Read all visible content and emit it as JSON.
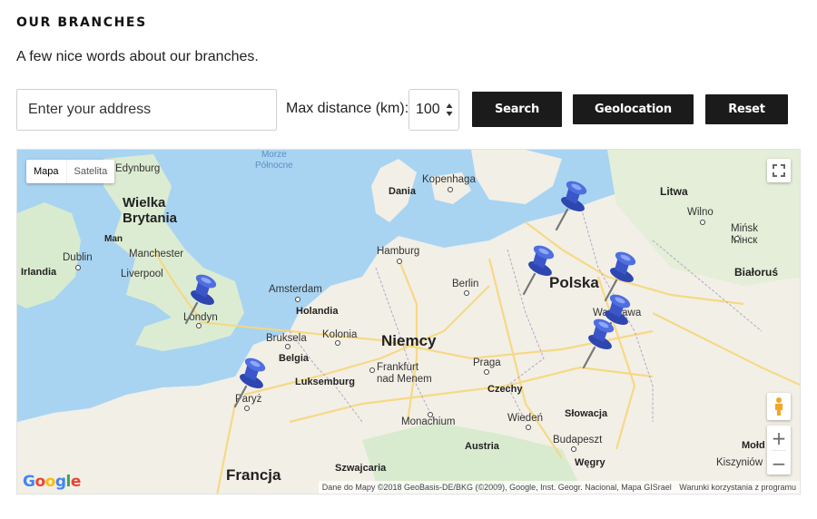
{
  "header": {
    "title": "OUR BRANCHES",
    "subtitle": "A few nice words about our branches."
  },
  "search": {
    "address_placeholder": "Enter your address",
    "max_distance_label": "Max distance (km):",
    "max_distance_value": "100",
    "search_label": "Search",
    "geolocation_label": "Geolocation",
    "reset_label": "Reset"
  },
  "map": {
    "type_control": {
      "map_label": "Mapa",
      "satellite_label": "Satelita",
      "active": "Mapa"
    },
    "labels": {
      "sea_north": "Morze\nPółnocne",
      "edinburgh": "Edynburg",
      "great_britain": "Wielka\nBrytania",
      "isle_of_man": "Man",
      "manchester": "Manchester",
      "dublin": "Dublin",
      "ireland": "Irlandia",
      "liverpool": "Liverpool",
      "london": "Londyn",
      "amsterdam": "Amsterdam",
      "netherlands": "Holandia",
      "brussels": "Bruksela",
      "belgium": "Belgia",
      "cologne": "Kolonia",
      "luxembourg": "Luksemburg",
      "paris": "Paryż",
      "france": "Francja",
      "strasbourg": "Szwajcaria",
      "hamburg": "Hamburg",
      "denmark": "Dania",
      "copenhagen": "Kopenhaga",
      "germany": "Niemcy",
      "berlin": "Berlin",
      "frankfurt": "Frankfurt\nnad Menem",
      "prague": "Praga",
      "czechia": "Czechy",
      "munich": "Monachium",
      "vienna": "Wiedeń",
      "austria": "Austria",
      "slovakia": "Słowacja",
      "budapest": "Budapeszt",
      "hungary": "Węgry",
      "poland": "Polska",
      "warsaw": "Warszawa",
      "lithuania": "Litwa",
      "vilnius": "Wilno",
      "minsk": "Mińsk\nМінск",
      "belarus": "Białoruś",
      "moldova": "Mołd",
      "kishinev": "Kiszyniów"
    },
    "pin_count": 7,
    "google_logo": "Google",
    "attribution": "Dane do Mapy ©2018 GeoBasis-DE/BKG (©2009), Google, Inst. Geogr. Nacional, Mapa GISrael",
    "terms": "Warunki korzystania z programu",
    "colors": {
      "water": "#a8d4f2",
      "land": "#f2efe6",
      "land_green": "#d8ebcf",
      "road": "#f7d77c",
      "pin": "#3a56c8"
    }
  }
}
